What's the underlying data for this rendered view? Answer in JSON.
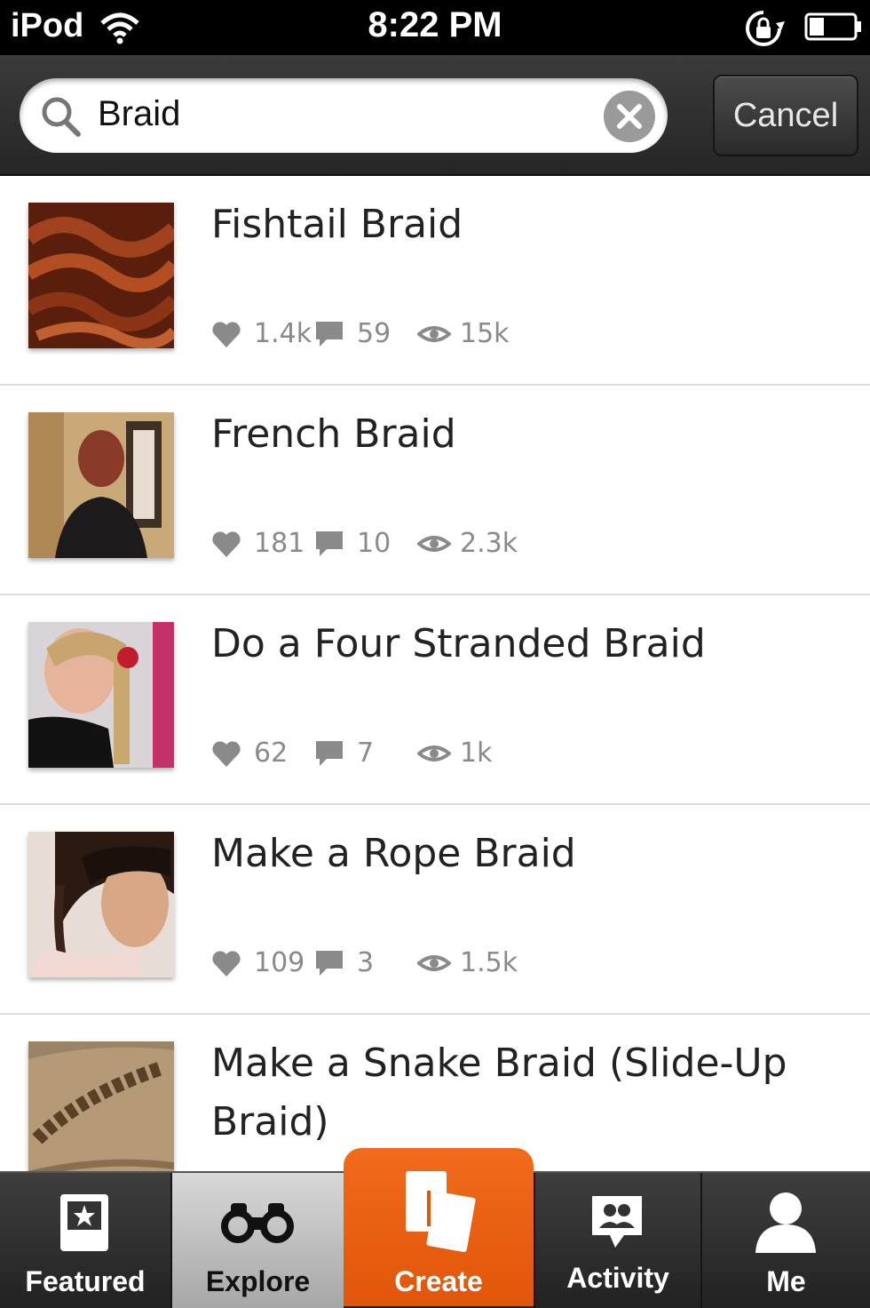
{
  "status_bar": {
    "carrier": "iPod",
    "time": "8:22 PM"
  },
  "search": {
    "query": "Braid",
    "cancel_label": "Cancel"
  },
  "results": [
    {
      "title": "Fishtail Braid",
      "likes": "1.4k",
      "comments": "59",
      "views": "15k"
    },
    {
      "title": "French Braid",
      "likes": "181",
      "comments": "10",
      "views": "2.3k"
    },
    {
      "title": "Do a Four Stranded Braid",
      "likes": "62",
      "comments": "7",
      "views": "1k"
    },
    {
      "title": "Make a Rope Braid",
      "likes": "109",
      "comments": "3",
      "views": "1.5k"
    },
    {
      "title": "Make a Snake Braid (Slide-Up Braid)",
      "likes": "",
      "comments": "",
      "views": ""
    }
  ],
  "tabs": {
    "featured": "Featured",
    "explore": "Explore",
    "create": "Create",
    "activity": "Activity",
    "me": "Me"
  },
  "colors": {
    "accent": "#e85f10",
    "tabbar": "#2e2e2e",
    "stat_gray": "#8a8a8a"
  }
}
